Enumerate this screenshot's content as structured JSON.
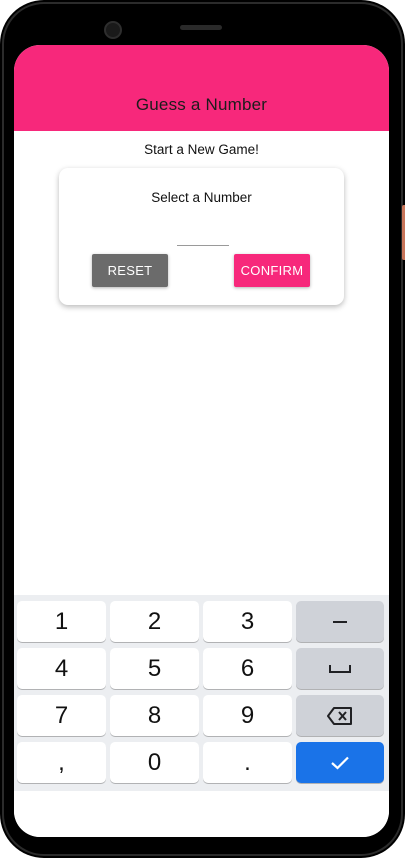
{
  "app": {
    "title": "Guess a Number",
    "subtitle": "Start a New Game!"
  },
  "card": {
    "title": "Select a Number",
    "input_value": "",
    "reset_label": "RESET",
    "confirm_label": "CONFIRM"
  },
  "keyboard": {
    "rows": [
      [
        "1",
        "2",
        "3"
      ],
      [
        "4",
        "5",
        "6"
      ],
      [
        "7",
        "8",
        "9"
      ],
      [
        ",",
        "0",
        "."
      ]
    ],
    "func_keys": [
      "minus-icon",
      "space-icon",
      "backspace-icon",
      "checkmark-icon"
    ]
  },
  "colors": {
    "accent": "#f7287b",
    "reset_button": "#6b6b6b",
    "enter_key": "#1a73e8"
  }
}
